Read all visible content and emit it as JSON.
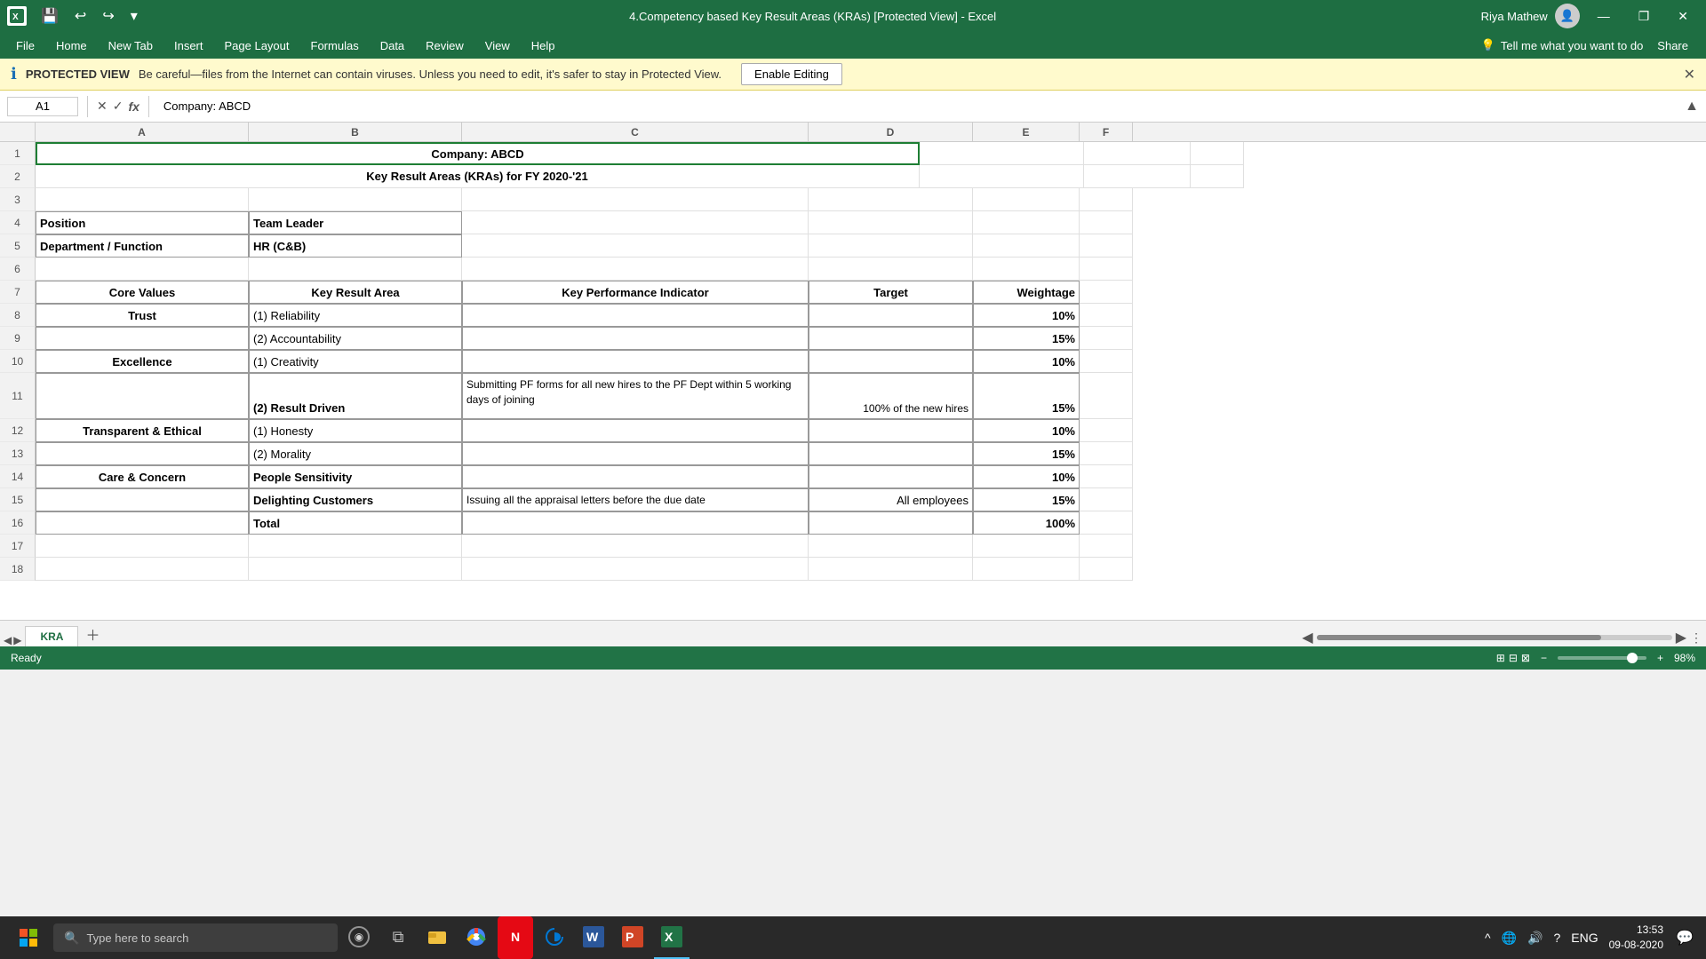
{
  "titlebar": {
    "filename": "4.Competency based Key Result Areas (KRAs)  [Protected View] - Excel",
    "user": "Riya Mathew",
    "min": "—",
    "max": "❐",
    "close": "✕"
  },
  "menubar": {
    "items": [
      "File",
      "Home",
      "New Tab",
      "Insert",
      "Page Layout",
      "Formulas",
      "Data",
      "Review",
      "View",
      "Help"
    ],
    "search_placeholder": "Tell me what you want to do",
    "share": "Share"
  },
  "protected": {
    "icon": "ℹ",
    "title": "PROTECTED VIEW",
    "message": "Be careful—files from the Internet can contain viruses. Unless you need to edit, it's safer to stay in Protected View.",
    "btn": "Enable Editing"
  },
  "formula_bar": {
    "cell_ref": "A1",
    "formula": "Company: ABCD"
  },
  "columns": {
    "headers": [
      "A",
      "B",
      "C",
      "D",
      "E",
      "F"
    ],
    "row_numbers": [
      1,
      2,
      3,
      4,
      5,
      6,
      7,
      8,
      9,
      10,
      11,
      12,
      13,
      14,
      15,
      16,
      17,
      18
    ]
  },
  "spreadsheet": {
    "row1": {
      "merged": "Company: ABCD"
    },
    "row2": {
      "merged": "Key Result Areas (KRAs) for FY 2020-'21"
    },
    "row3": {},
    "row4": {
      "a": "Position",
      "b": "Team Leader"
    },
    "row5": {
      "a": "Department / Function",
      "b": "HR (C&B)"
    },
    "row6": {},
    "row7": {
      "a": "Core Values",
      "b": "Key Result Area",
      "c": "Key Performance Indicator",
      "d": "Target",
      "e": "Weightage"
    },
    "row8": {
      "a": "Trust",
      "b": "(1) Reliability",
      "e": "10%"
    },
    "row9": {
      "b": "(2) Accountability",
      "e": "15%"
    },
    "row10": {
      "a": "Excellence",
      "b": "(1) Creativity",
      "e": "10%"
    },
    "row11_tall": true,
    "row11": {
      "b": "(2) Result Driven",
      "c": "Submitting PF forms for all new hires to the PF Dept within 5 working days of joining",
      "d": "100% of the new hires",
      "e": "15%"
    },
    "row12": {
      "a": "Transparent & Ethical",
      "b": "(1) Honesty",
      "e": "10%"
    },
    "row13": {
      "b": "(2) Morality",
      "e": "15%"
    },
    "row14": {
      "a": "Care & Concern",
      "b": "People Sensitivity",
      "e": "10%"
    },
    "row15": {
      "b": "Delighting Customers",
      "c": "Issuing all the appraisal letters before the due date",
      "d": "All employees",
      "e": "15%"
    },
    "row16": {
      "b": "Total",
      "e": "100%"
    },
    "row17": {},
    "row18": {}
  },
  "tabs": {
    "active": "KRA"
  },
  "statusbar": {
    "status": "Ready",
    "zoom": "98%"
  },
  "taskbar": {
    "search_placeholder": "Type here to search",
    "time": "13:53",
    "date": "09-08-2020",
    "lang": "ENG"
  }
}
